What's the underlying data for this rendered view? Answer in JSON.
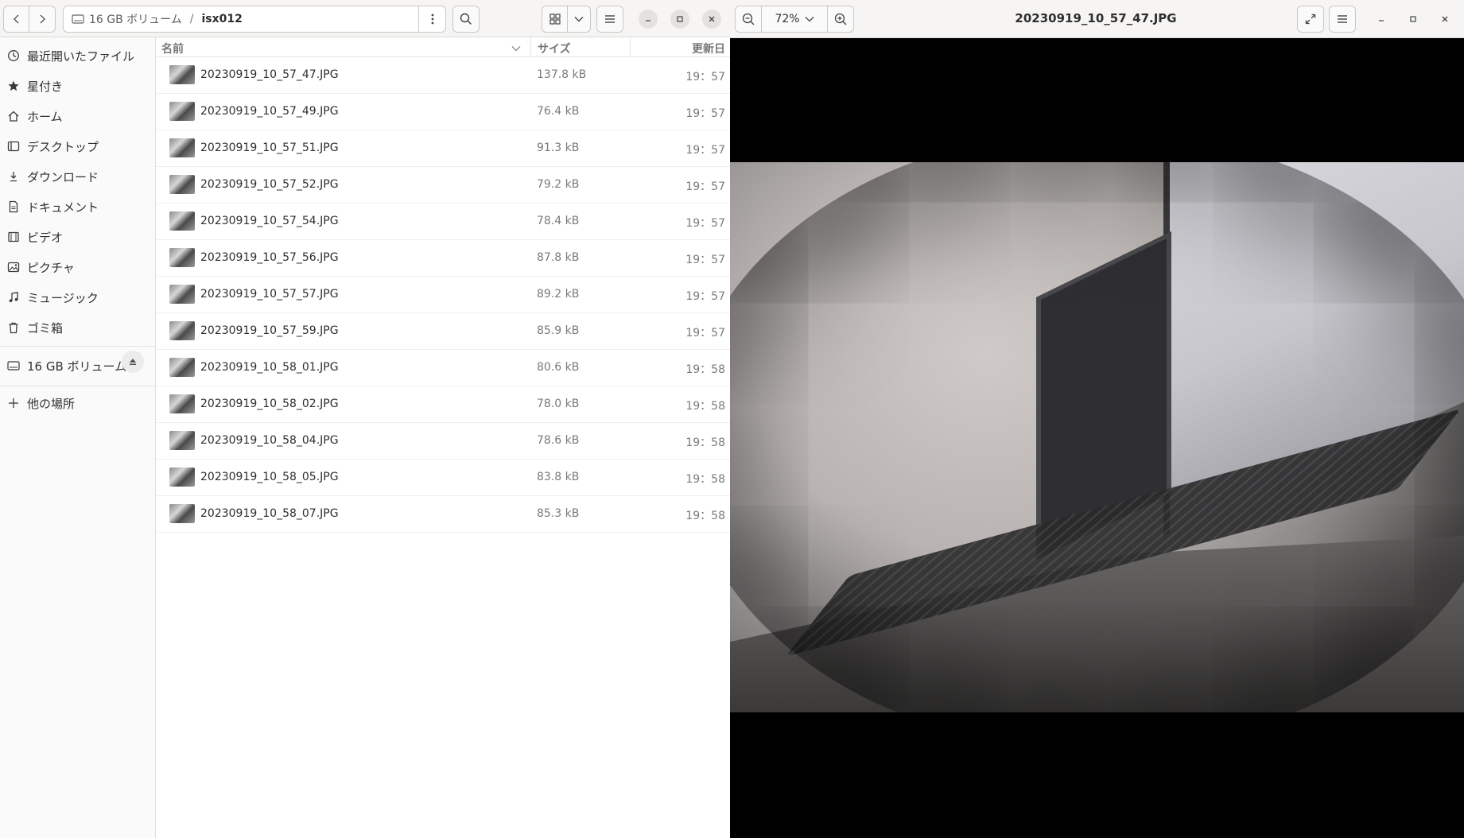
{
  "file_manager": {
    "path": {
      "volume": "16 GB ボリューム",
      "separator": "/",
      "current": "isx012"
    },
    "sidebar": [
      {
        "label": "最近開いたファイル",
        "icon": "clock-icon"
      },
      {
        "label": "星付き",
        "icon": "star-icon"
      },
      {
        "label": "ホーム",
        "icon": "home-icon"
      },
      {
        "label": "デスクトップ",
        "icon": "desktop-icon"
      },
      {
        "label": "ダウンロード",
        "icon": "download-icon"
      },
      {
        "label": "ドキュメント",
        "icon": "document-icon"
      },
      {
        "label": "ビデオ",
        "icon": "video-icon"
      },
      {
        "label": "ピクチャ",
        "icon": "picture-icon"
      },
      {
        "label": "ミュージック",
        "icon": "music-icon"
      },
      {
        "label": "ゴミ箱",
        "icon": "trash-icon"
      }
    ],
    "volume_item": {
      "label": "16 GB ボリューム",
      "icon": "drive-icon"
    },
    "other_places": {
      "label": "他の場所",
      "icon": "plus-icon"
    },
    "columns": {
      "name": "名前",
      "size": "サイズ",
      "modified": "更新日"
    },
    "files": [
      {
        "name": "20230919_10_57_47.JPG",
        "size": "137.8 kB",
        "modified": "19：57"
      },
      {
        "name": "20230919_10_57_49.JPG",
        "size": "76.4 kB",
        "modified": "19：57"
      },
      {
        "name": "20230919_10_57_51.JPG",
        "size": "91.3 kB",
        "modified": "19：57"
      },
      {
        "name": "20230919_10_57_52.JPG",
        "size": "79.2 kB",
        "modified": "19：57"
      },
      {
        "name": "20230919_10_57_54.JPG",
        "size": "78.4 kB",
        "modified": "19：57"
      },
      {
        "name": "20230919_10_57_56.JPG",
        "size": "87.8 kB",
        "modified": "19：57"
      },
      {
        "name": "20230919_10_57_57.JPG",
        "size": "89.2 kB",
        "modified": "19：57"
      },
      {
        "name": "20230919_10_57_59.JPG",
        "size": "85.9 kB",
        "modified": "19：57"
      },
      {
        "name": "20230919_10_58_01.JPG",
        "size": "80.6 kB",
        "modified": "19：58"
      },
      {
        "name": "20230919_10_58_02.JPG",
        "size": "78.0 kB",
        "modified": "19：58"
      },
      {
        "name": "20230919_10_58_04.JPG",
        "size": "78.6 kB",
        "modified": "19：58"
      },
      {
        "name": "20230919_10_58_05.JPG",
        "size": "83.8 kB",
        "modified": "19：58"
      },
      {
        "name": "20230919_10_58_07.JPG",
        "size": "85.3 kB",
        "modified": "19：58"
      }
    ]
  },
  "viewer": {
    "title": "20230919_10_57_47.JPG",
    "zoom": "72%"
  }
}
